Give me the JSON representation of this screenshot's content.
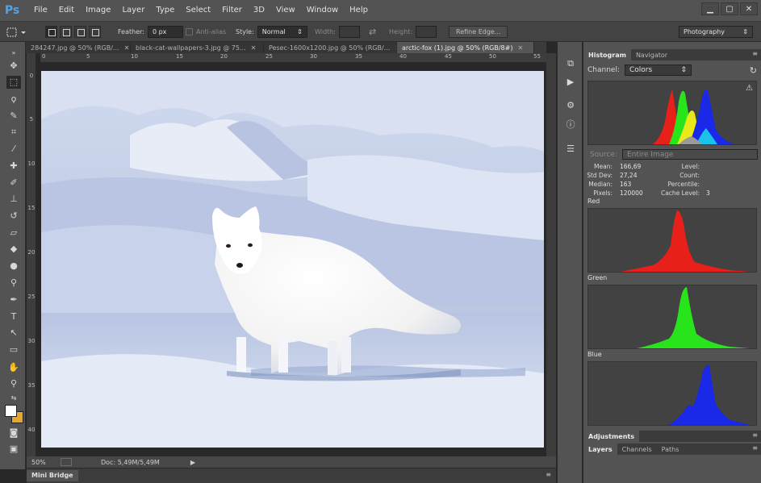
{
  "app": {
    "logo": "Ps"
  },
  "menu": [
    "File",
    "Edit",
    "Image",
    "Layer",
    "Type",
    "Select",
    "Filter",
    "3D",
    "View",
    "Window",
    "Help"
  ],
  "window_controls": {
    "minimize": "▁",
    "maximize": "▢",
    "close": "✕"
  },
  "options": {
    "feather_label": "Feather:",
    "feather_value": "0 px",
    "antialias_label": "Anti-alias",
    "style_label": "Style:",
    "style_value": "Normal",
    "width_label": "Width:",
    "swap_icon": "⇄",
    "height_label": "Height:",
    "refine_edge": "Refine Edge...",
    "workspace": "Photography"
  },
  "tabs": [
    {
      "label": "284247.jpg @ 50% (RGB/...",
      "close": "✕"
    },
    {
      "label": "black-cat-wallpapers-3.jpg @ 75...",
      "close": "✕"
    },
    {
      "label": "Pesec-1600x1200.jpg @ 50% (RGB/...",
      "close": "✕"
    },
    {
      "label": "arctic-fox (1).jpg @ 50% (RGB/8#)",
      "close": "✕"
    }
  ],
  "ruler_top": [
    "0",
    "5",
    "10",
    "15",
    "20",
    "25",
    "30",
    "35",
    "40",
    "45",
    "50",
    "55"
  ],
  "ruler_left": [
    "0",
    "5",
    "10",
    "15",
    "20",
    "25",
    "30",
    "35",
    "40"
  ],
  "status": {
    "zoom": "50%",
    "doc": "Doc: 5,49M/5,49M",
    "arrow": "▶"
  },
  "mini_bridge": {
    "label": "Mini Bridge",
    "menu": "≡"
  },
  "right_panel": {
    "tabs": [
      "Histogram",
      "Navigator"
    ],
    "panel_menu": "≡",
    "channel_label": "Channel:",
    "channel_value": "Colors",
    "refresh_icon": "↻",
    "warning_icon": "⚠",
    "source_label": "Source:",
    "source_value": "Entire Image",
    "stats": {
      "mean_label": "Mean:",
      "mean": "166,69",
      "stddev_label": "Std Dev:",
      "stddev": "27,24",
      "median_label": "Median:",
      "median": "163",
      "pixels_label": "Pixels:",
      "pixels": "120000",
      "level_label": "Level:",
      "level": "",
      "count_label": "Count:",
      "count": "",
      "percentile_label": "Percentile:",
      "percentile": "",
      "cache_label": "Cache Level:",
      "cache": "3"
    },
    "red_label": "Red",
    "green_label": "Green",
    "blue_label": "Blue",
    "adjustments": "Adjustments",
    "bottom_tabs": [
      "Layers",
      "Channels",
      "Paths"
    ]
  },
  "colors": {
    "accent_blue": "#4ea3e9",
    "foreground": "#ffffff",
    "background": "#e8a72b",
    "red": "#e8201a",
    "green": "#28e41a",
    "blue": "#1a28e8"
  }
}
